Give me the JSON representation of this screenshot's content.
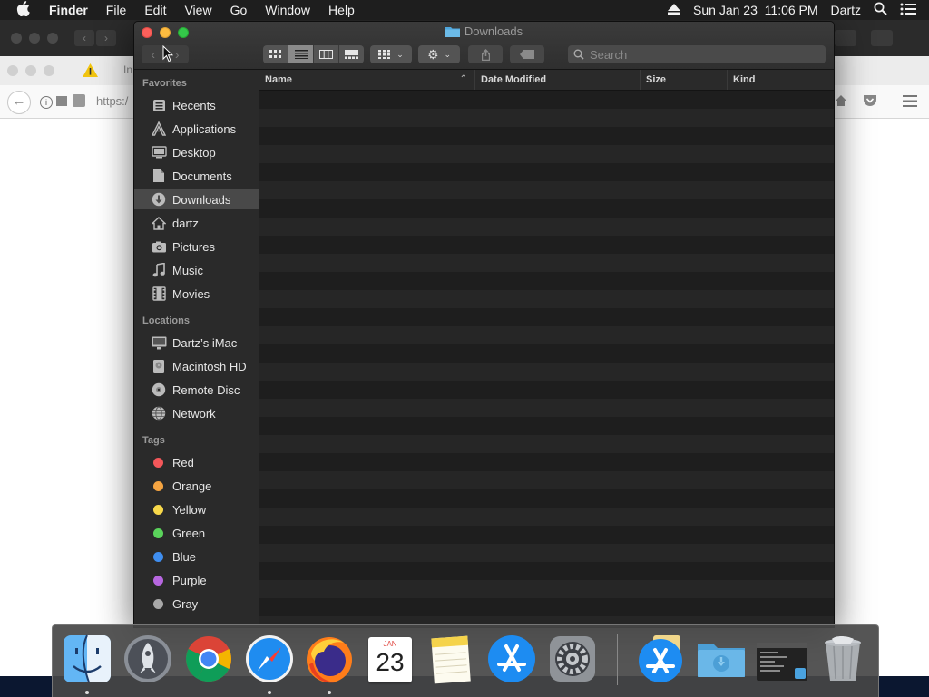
{
  "menubar": {
    "app_name": "Finder",
    "menus": [
      "File",
      "Edit",
      "View",
      "Go",
      "Window",
      "Help"
    ],
    "clock": "Sun Jan 23  11:06 PM",
    "user": "Dartz"
  },
  "browser": {
    "tab_label": "In",
    "url_prefix": "https:/"
  },
  "finder": {
    "title": "Downloads",
    "search_placeholder": "Search",
    "sidebar": {
      "favorites_header": "Favorites",
      "favorites": [
        {
          "label": "Recents",
          "icon": "recents-icon"
        },
        {
          "label": "Applications",
          "icon": "applications-icon"
        },
        {
          "label": "Desktop",
          "icon": "desktop-icon"
        },
        {
          "label": "Documents",
          "icon": "documents-icon"
        },
        {
          "label": "Downloads",
          "icon": "downloads-icon",
          "selected": true
        },
        {
          "label": "dartz",
          "icon": "home-icon"
        },
        {
          "label": "Pictures",
          "icon": "pictures-icon"
        },
        {
          "label": "Music",
          "icon": "music-icon"
        },
        {
          "label": "Movies",
          "icon": "movies-icon"
        }
      ],
      "locations_header": "Locations",
      "locations": [
        {
          "label": "Dartz’s iMac",
          "icon": "imac-icon"
        },
        {
          "label": "Macintosh HD",
          "icon": "hard-drive-icon"
        },
        {
          "label": "Remote Disc",
          "icon": "disc-icon"
        },
        {
          "label": "Network",
          "icon": "network-icon"
        }
      ],
      "tags_header": "Tags",
      "tags": [
        {
          "label": "Red",
          "color": "#f4575a"
        },
        {
          "label": "Orange",
          "color": "#f5a441"
        },
        {
          "label": "Yellow",
          "color": "#f7d84a"
        },
        {
          "label": "Green",
          "color": "#5ad35b"
        },
        {
          "label": "Blue",
          "color": "#3f8ef0"
        },
        {
          "label": "Purple",
          "color": "#b767e0"
        },
        {
          "label": "Gray",
          "color": "#a8a8a8"
        }
      ]
    },
    "columns": {
      "name": "Name",
      "date_modified": "Date Modified",
      "size": "Size",
      "kind": "Kind"
    }
  },
  "dock": {
    "calendar_month": "JAN",
    "calendar_day": "23",
    "apps": [
      "Finder",
      "Launchpad",
      "Chrome",
      "Safari",
      "Firefox",
      "Calendar",
      "Notes",
      "App Store",
      "System Preferences"
    ],
    "trailing": [
      "App Store Downloads",
      "Downloads Folder",
      "Terminal Window",
      "Trash"
    ]
  }
}
